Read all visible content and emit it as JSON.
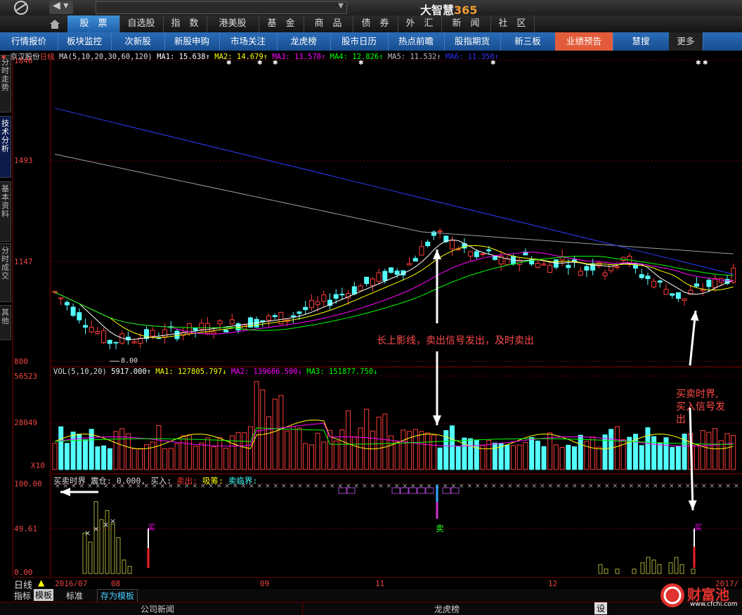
{
  "topbar": {
    "app_title": "大智慧",
    "app_suffix": "365",
    "back_icon": "back-arrow-icon",
    "forward_icon": "forward-arrow-icon"
  },
  "nav_tabs": [
    "股　票",
    "自选股",
    "指　数",
    "港美股",
    "基　金",
    "商　品",
    "债　券",
    "外　汇",
    "新　闻",
    "社　区"
  ],
  "sub_tabs": [
    "行情报价",
    "板块监控",
    "次新股",
    "新股申购",
    "市场关注",
    "龙虎榜",
    "股市日历",
    "热点前瞻",
    "股指期货",
    "新三板",
    "业绩预告",
    "慧搜",
    "更多"
  ],
  "side_tabs": [
    "分时走势",
    "技术分析",
    "基本资料",
    "分时成交",
    "其他"
  ],
  "chart_header": {
    "stock": "京汉股份",
    "period": "日线",
    "ma_params": "MA(5,10,20,30,60,120)",
    "ma1": "MA1: 15.638↑",
    "ma2": "MA2: 14.679↑",
    "ma3": "MA3: 13.578↑",
    "ma4": "MA4: 12.826↑",
    "ma5": "MA5: 11.532↑",
    "ma6": "MA6: 11.350↑"
  },
  "vol_header": {
    "params": "VOL(5,10,20)",
    "vol": "5917.000↑",
    "ma1": "MA1: 127805.797↓",
    "ma2": "MA2: 139686.500↓",
    "ma3": "MA3: 151877.750↓"
  },
  "ind_header": {
    "name": "买卖时界",
    "cang": "震仓: 0.000,",
    "buy": "买入:",
    "sell": "卖出:",
    "absorb": "吸筹:",
    "critical": "卖临界:"
  },
  "price_axis": [
    "1846",
    "1493",
    "1147",
    "800"
  ],
  "price_scale_labels": {
    "top": "1846",
    "q1": "1493",
    "q2": "1147",
    "bottom": "800"
  },
  "vol_axis": [
    "56523",
    "28049"
  ],
  "vol_multiplier": "X10",
  "ind_axis": [
    "100.00",
    "49.61",
    "0.00"
  ],
  "min_price_label": "8.00",
  "annotations": {
    "sell_note": "长上影线，卖出信号发出，及时卖出",
    "buy_note_1": "买卖时界,",
    "buy_note_2": "买入信号发",
    "buy_note_3": "出",
    "sell_mark": "卖",
    "buy_mark": "买"
  },
  "date_axis": {
    "period": "日线",
    "labels": [
      "2016/07",
      "08",
      "09",
      "11",
      "12",
      "2017/"
    ]
  },
  "bottom_tabs": {
    "indicator": "指标",
    "template": "模板",
    "standard": "标准",
    "save_template": "存为模板"
  },
  "status_bar": {
    "company_news": "公司新闻",
    "dragon": "龙虎榜",
    "settings": "设"
  },
  "watermark": {
    "name": "财富池",
    "url": "www.cfchi.com"
  },
  "colors": {
    "up": "#ff3d3d",
    "down": "#54ffff",
    "ma1": "#ffffff",
    "ma2": "#ffff00",
    "ma3": "#ff00ff",
    "ma4": "#00ff00",
    "ma5": "#9aa0a0",
    "ma6": "#2b3fff"
  }
}
